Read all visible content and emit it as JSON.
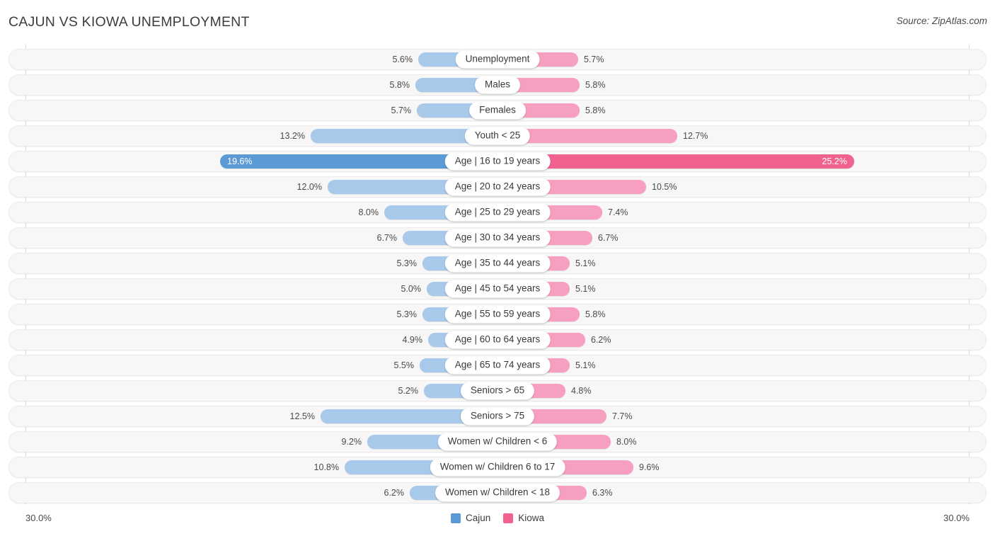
{
  "header": {
    "title": "CAJUN VS KIOWA UNEMPLOYMENT",
    "source": "Source: ZipAtlas.com"
  },
  "axis": {
    "left_tick": "30.0%",
    "right_tick": "30.0%"
  },
  "legend": {
    "items": [
      {
        "label": "Cajun",
        "color": "#5b9bd5"
      },
      {
        "label": "Kiowa",
        "color": "#f2628f"
      }
    ]
  },
  "colors": {
    "left_bar": "#a8c9ea",
    "left_bar_max": "#5b9bd5",
    "right_bar": "#f79fc0",
    "right_bar_max": "#f2628f",
    "row_track": "#f7f7f7"
  },
  "chart_data": {
    "type": "bar",
    "title": "CAJUN VS KIOWA UNEMPLOYMENT",
    "subtitle": "Source: ZipAtlas.com",
    "orientation": "horizontal-diverging",
    "xlabel": "",
    "ylabel": "",
    "xlim": [
      0,
      30
    ],
    "axis_max": 30.0,
    "unit": "%",
    "grid": false,
    "legend_position": "bottom-center",
    "categories": [
      "Unemployment",
      "Males",
      "Females",
      "Youth < 25",
      "Age | 16 to 19 years",
      "Age | 20 to 24 years",
      "Age | 25 to 29 years",
      "Age | 30 to 34 years",
      "Age | 35 to 44 years",
      "Age | 45 to 54 years",
      "Age | 55 to 59 years",
      "Age | 60 to 64 years",
      "Age | 65 to 74 years",
      "Seniors > 65",
      "Seniors > 75",
      "Women w/ Children < 6",
      "Women w/ Children 6 to 17",
      "Women w/ Children < 18"
    ],
    "series": [
      {
        "name": "Cajun",
        "side": "left",
        "color": "#a8c9ea",
        "values": [
          5.6,
          5.8,
          5.7,
          13.2,
          19.6,
          12.0,
          8.0,
          6.7,
          5.3,
          5.0,
          5.3,
          4.9,
          5.5,
          5.2,
          12.5,
          9.2,
          10.8,
          6.2
        ],
        "labels": [
          "5.6%",
          "5.8%",
          "5.7%",
          "13.2%",
          "19.6%",
          "12.0%",
          "8.0%",
          "6.7%",
          "5.3%",
          "5.0%",
          "5.3%",
          "4.9%",
          "5.5%",
          "5.2%",
          "12.5%",
          "9.2%",
          "10.8%",
          "6.2%"
        ]
      },
      {
        "name": "Kiowa",
        "side": "right",
        "color": "#f79fc0",
        "values": [
          5.7,
          5.8,
          5.8,
          12.7,
          25.2,
          10.5,
          7.4,
          6.7,
          5.1,
          5.1,
          5.8,
          6.2,
          5.1,
          4.8,
          7.7,
          8.0,
          9.6,
          6.3
        ],
        "labels": [
          "5.7%",
          "5.8%",
          "5.8%",
          "12.7%",
          "25.2%",
          "10.5%",
          "7.4%",
          "6.7%",
          "5.1%",
          "5.1%",
          "5.8%",
          "6.2%",
          "5.1%",
          "4.8%",
          "7.7%",
          "8.0%",
          "9.6%",
          "6.3%"
        ]
      }
    ],
    "highlighted_row": "Age | 16 to 19 years"
  }
}
